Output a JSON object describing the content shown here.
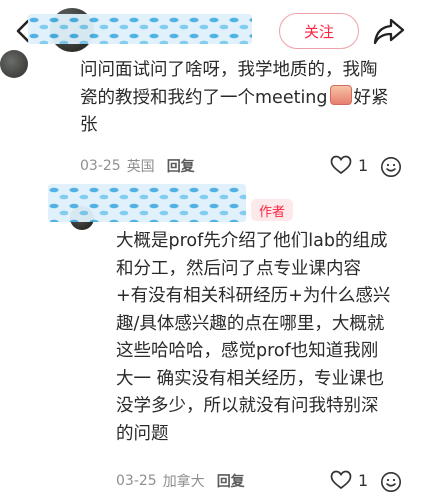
{
  "header": {
    "follow_label": "关注"
  },
  "comment": {
    "line1": "问问面试问了啥呀，我学地质的，我陶",
    "line2_a": "瓷的教授和我约了一个meeting",
    "line2_b": "好紧",
    "line3": "张",
    "date": "03-25",
    "location": "英国",
    "reply_label": "回复",
    "likes": "1"
  },
  "reply": {
    "author_tag": "作者",
    "lines": [
      "大概是prof先介绍了他们lab的组成",
      "和分工，然后问了点专业课内容",
      "+有没有相关科研经历+为什么感兴",
      "趣/具体感兴趣的点在哪里，大概就",
      "这些哈哈哈，感觉prof也知道我刚",
      "大一 确实没有相关经历，专业课也",
      "没学多少，所以就没有问我特别深",
      "的问题"
    ],
    "date": "03-25",
    "location": "加拿大",
    "reply_label": "回复",
    "likes": "1"
  },
  "colors": {
    "accent": "#ff2442",
    "meta_text": "#8f8f8f"
  }
}
